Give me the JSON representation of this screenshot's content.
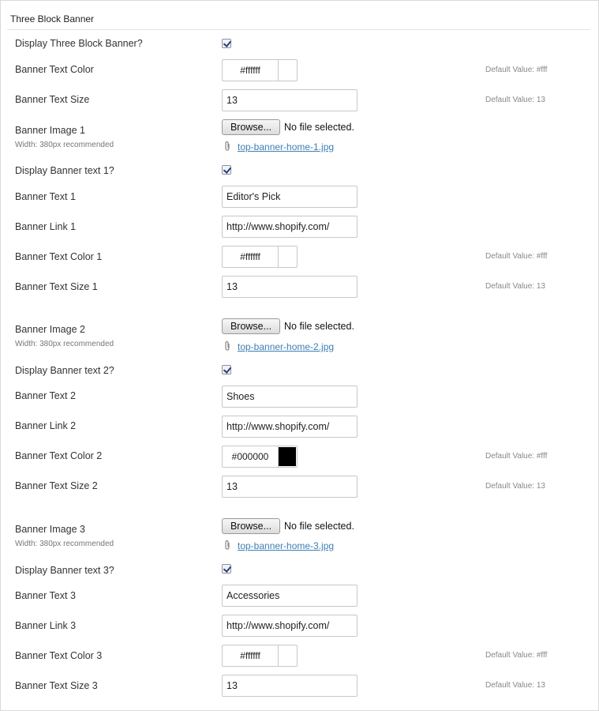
{
  "section": {
    "title": "Three Block Banner"
  },
  "general": {
    "display_label": "Display Three Block Banner?",
    "display_checked": true,
    "text_color_label": "Banner Text Color",
    "text_color_value": "#ffffff",
    "text_color_swatch": "#ffffff",
    "text_color_default": "Default Value: #fff",
    "text_size_label": "Banner Text Size",
    "text_size_value": "13",
    "text_size_default": "Default Value: 13"
  },
  "banners": [
    {
      "image_label": "Banner Image 1",
      "image_hint": "Width: 380px recommended",
      "browse_label": "Browse...",
      "no_file_text": "No file selected.",
      "file_name": "top-banner-home-1.jpg",
      "display_text_label": "Display Banner text 1?",
      "display_text_checked": true,
      "text_label": "Banner Text 1",
      "text_value": "Editor's Pick",
      "link_label": "Banner Link 1",
      "link_value": "http://www.shopify.com/",
      "color_label": "Banner Text Color 1",
      "color_value": "#ffffff",
      "color_swatch": "#ffffff",
      "color_default": "Default Value: #fff",
      "size_label": "Banner Text Size 1",
      "size_value": "13",
      "size_default": "Default Value: 13"
    },
    {
      "image_label": "Banner Image 2",
      "image_hint": "Width: 380px recommended",
      "browse_label": "Browse...",
      "no_file_text": "No file selected.",
      "file_name": "top-banner-home-2.jpg",
      "display_text_label": "Display Banner text 2?",
      "display_text_checked": true,
      "text_label": "Banner Text 2",
      "text_value": "Shoes",
      "link_label": "Banner Link 2",
      "link_value": "http://www.shopify.com/",
      "color_label": "Banner Text Color 2",
      "color_value": "#000000",
      "color_swatch": "#000000",
      "color_default": "Default Value: #fff",
      "size_label": "Banner Text Size 2",
      "size_value": "13",
      "size_default": "Default Value: 13"
    },
    {
      "image_label": "Banner Image 3",
      "image_hint": "Width: 380px recommended",
      "browse_label": "Browse...",
      "no_file_text": "No file selected.",
      "file_name": "top-banner-home-3.jpg",
      "display_text_label": "Display Banner text 3?",
      "display_text_checked": true,
      "text_label": "Banner Text 3",
      "text_value": "Accessories",
      "link_label": "Banner Link 3",
      "link_value": "http://www.shopify.com/",
      "color_label": "Banner Text Color 3",
      "color_value": "#ffffff",
      "color_swatch": "#ffffff",
      "color_default": "Default Value: #fff",
      "size_label": "Banner Text Size 3",
      "size_value": "13",
      "size_default": "Default Value: 13"
    }
  ]
}
